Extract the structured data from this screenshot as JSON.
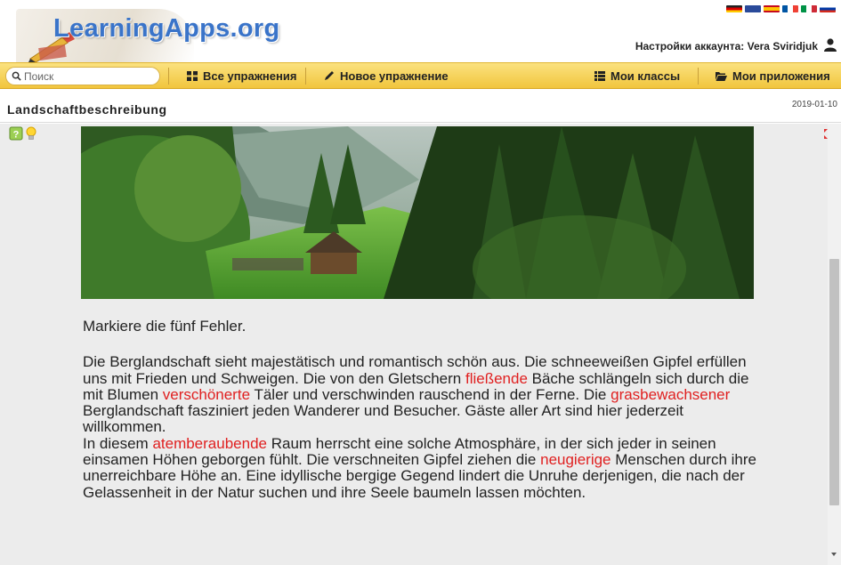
{
  "header": {
    "logo_text": "LearningApps.org",
    "account_label": "Настройки аккаунта: Vera Sviridjuk"
  },
  "nav": {
    "search_placeholder": "Поиск",
    "all_exercises": "Все упражнения",
    "new_exercise": "Новое упражнение",
    "my_classes": "Мои классы",
    "my_apps": "Мои приложения"
  },
  "app": {
    "title": "Landschaftbeschreibung",
    "date": "2019-01-10"
  },
  "exercise": {
    "instruction": "Markiere die fünf Fehler.",
    "segments": [
      {
        "text": "Die Berglandschaft sieht majestätisch und romantisch schön aus. Die schneeweißen Gipfel erfüllen uns mit Frieden und Schweigen. Die von den Gletschern ",
        "highlight": false
      },
      {
        "text": "fließende",
        "highlight": true
      },
      {
        "text": " Bäche schlängeln sich durch die mit Blumen ",
        "highlight": false
      },
      {
        "text": "verschönerte",
        "highlight": true
      },
      {
        "text": " Täler und verschwinden rauschend in der Ferne. Die ",
        "highlight": false
      },
      {
        "text": "grasbewachsener",
        "highlight": true
      },
      {
        "text": " Berglandschaft fasziniert jeden Wanderer und Besucher. Gäste aller Art sind hier jederzeit willkommen.",
        "highlight": false
      },
      {
        "text": "\n",
        "highlight": false
      },
      {
        "text": "In diesem ",
        "highlight": false
      },
      {
        "text": "atemberaubende",
        "highlight": true
      },
      {
        "text": " Raum herrscht eine solche Atmosphäre, in der sich jeder in seinen einsamen Höhen geborgen fühlt. Die verschneiten Gipfel ziehen die ",
        "highlight": false
      },
      {
        "text": "neugierige",
        "highlight": true
      },
      {
        "text": " Menschen durch ihre unerreichbare Höhe an. Eine idyllische bergige Gegend lindert die Unruhe derjenigen, die nach der Gelassenheit in der Natur suchen und ihre Seele baumeln lassen möchten.",
        "highlight": false
      }
    ]
  },
  "colors": {
    "highlight": "#e02020",
    "navbar": "#f5d35a",
    "logo": "#3a74c9"
  },
  "icons": [
    "search-icon",
    "grid-icon",
    "pencil-icon",
    "list-icon",
    "folder-icon",
    "user-icon",
    "help-icon",
    "bulb-icon",
    "fullscreen-icon"
  ]
}
